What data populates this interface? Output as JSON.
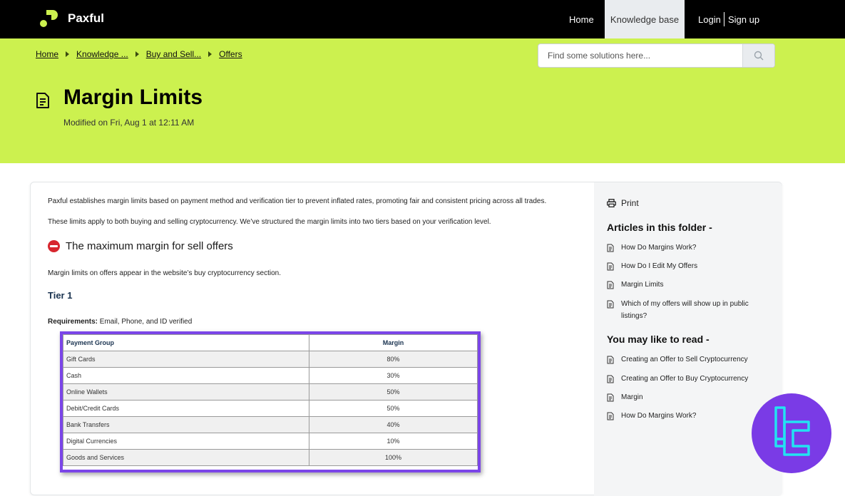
{
  "header": {
    "brand": "Paxful",
    "nav": {
      "home": "Home",
      "knowledge_base": "Knowledge base",
      "login": "Login",
      "signup": "Sign up"
    },
    "brand_color": "#ccf14f"
  },
  "hero": {
    "breadcrumb": [
      "Home",
      "Knowledge ...",
      "Buy and Sell...",
      "Offers"
    ],
    "search_placeholder": "Find some solutions here...",
    "title": "Margin Limits",
    "modified": "Modified on Fri, Aug 1 at 12:11 AM"
  },
  "article": {
    "intro": "Paxful establishes margin limits based on payment method and verification tier to prevent inflated rates, promoting fair and consistent pricing across all trades.",
    "intro2": "These limits apply to both buying and selling cryptocurrency. We’ve structured the margin limits into two tiers based on your verification level.",
    "section_heading": "The maximum margin for sell offers",
    "section_note": "Margin limits on offers appear in the website’s buy cryptocurrency section.",
    "tier_heading": "Tier 1",
    "requirements_label": "Requirements:",
    "requirements_value": " Email, Phone, and ID verified",
    "table": {
      "headers": [
        "Payment Group",
        "Margin"
      ],
      "rows": [
        [
          "Gift Cards",
          "80%"
        ],
        [
          "Cash",
          "30%"
        ],
        [
          "Online Wallets",
          "50%"
        ],
        [
          "Debit/Credit Cards",
          "50%"
        ],
        [
          "Bank Transfers",
          "40%"
        ],
        [
          "Digital Currencies",
          "10%"
        ],
        [
          "Goods and Services",
          "100%"
        ]
      ]
    }
  },
  "sidebar": {
    "print": "Print",
    "folder_heading": "Articles in this folder -",
    "folder_items": [
      "How Do Margins Work?",
      "How Do I Edit My Offers",
      "Margin Limits",
      "Which of my offers will show up in public listings?"
    ],
    "read_heading": "You may like to read -",
    "read_items": [
      "Creating an Offer to Sell Cryptocurrency",
      "Creating an Offer to Buy Cryptocurrency",
      "Margin",
      "How Do Margins Work?"
    ]
  }
}
